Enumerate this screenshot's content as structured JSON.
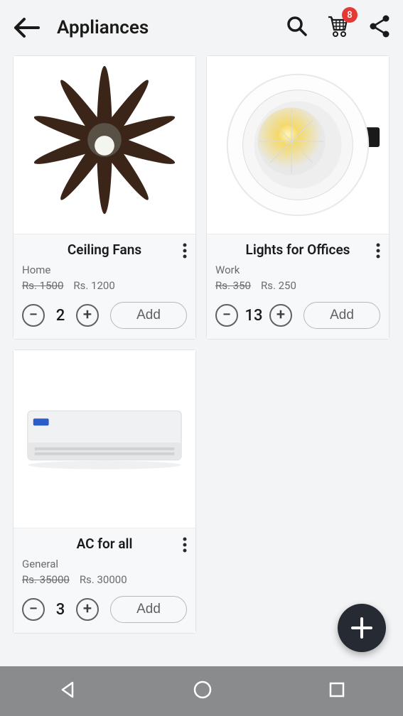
{
  "header": {
    "title": "Appliances",
    "cart_badge": "8"
  },
  "products": [
    {
      "title": "Ceiling Fans",
      "subtitle": "Home",
      "old_price": "Rs. 1500",
      "new_price": "Rs. 1200",
      "quantity": "2",
      "add_label": "Add"
    },
    {
      "title": "Lights for Offices",
      "subtitle": "Work",
      "old_price": "Rs. 350",
      "new_price": "Rs. 250",
      "quantity": "13",
      "add_label": "Add"
    },
    {
      "title": "AC for all",
      "subtitle": "General",
      "old_price": "Rs. 35000",
      "new_price": "Rs. 30000",
      "quantity": "3",
      "add_label": "Add"
    }
  ]
}
